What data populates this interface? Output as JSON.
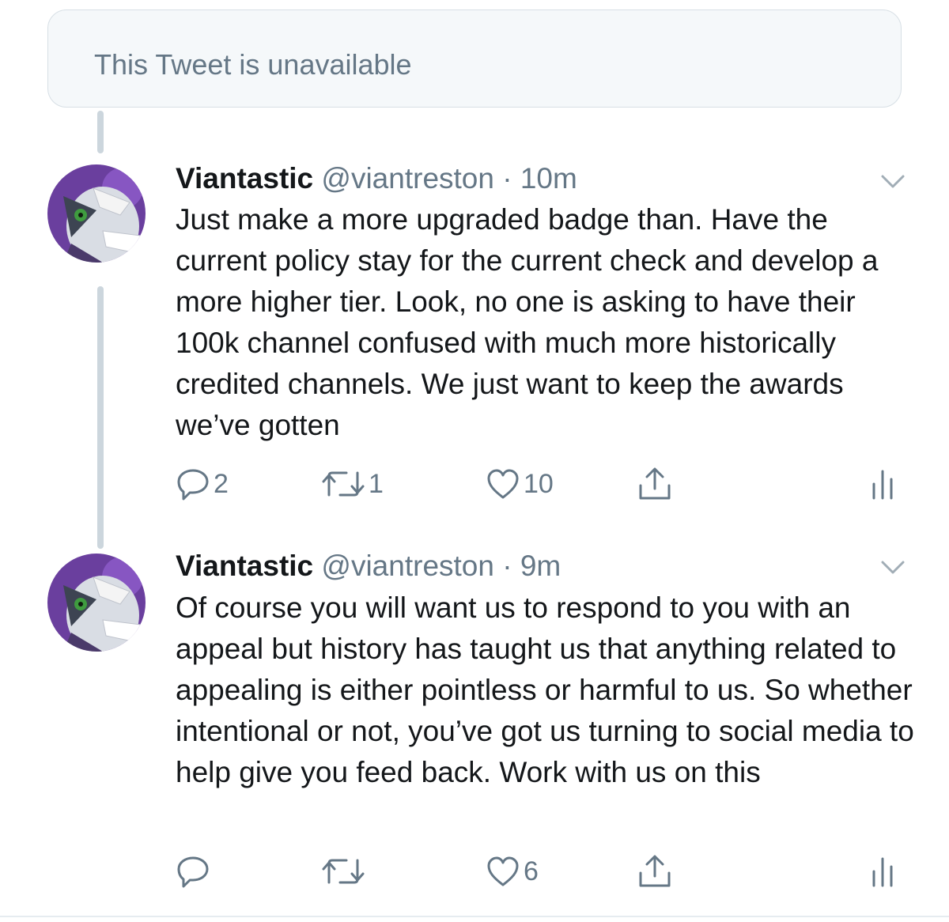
{
  "unavailable_text": "This Tweet is unavailable",
  "colors": {
    "text": "#14171a",
    "secondary": "#657786",
    "thread_line": "#ccd6dd",
    "card_bg": "#f5f8fa"
  },
  "tweets": [
    {
      "name": "Viantastic",
      "handle": "@viantreston",
      "time": "10m",
      "text": "Just make a more upgraded badge than. Have the current policy stay for the current check and develop a more higher tier. Look, no one is asking to have their 100k channel confused with much more historically credited channels. We just want to keep the awards we’ve gotten",
      "replies": "2",
      "retweets": "1",
      "likes": "10"
    },
    {
      "name": "Viantastic",
      "handle": "@viantreston",
      "time": "9m",
      "text": "Of course you will want us to respond to you with an appeal but history has taught us that anything related to appealing is either pointless or harmful to us. So whether intentional or not, you’ve got us turning to social media to help give you feed back. Work with us on this",
      "replies": "",
      "retweets": "",
      "likes": "6"
    }
  ],
  "icons": {
    "reply": "reply-icon",
    "retweet": "retweet-icon",
    "like": "heart-icon",
    "share": "share-icon",
    "analytics": "analytics-icon",
    "caret": "chevron-down-icon",
    "avatar": "avatar-image"
  }
}
